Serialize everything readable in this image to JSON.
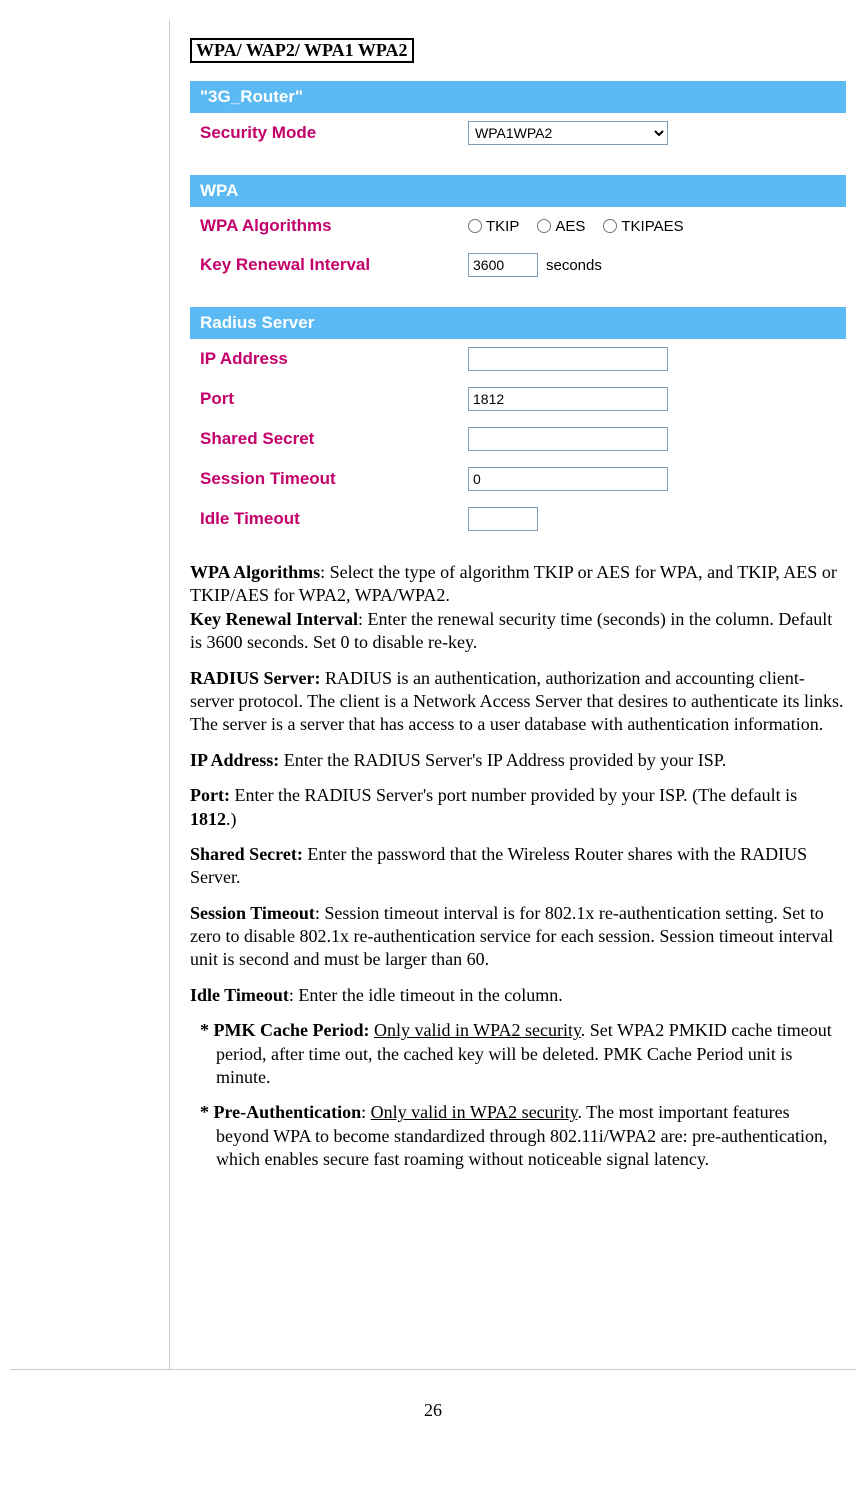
{
  "heading": "WPA/ WAP2/ WPA1 WPA2",
  "panel": {
    "bar_router": "\"3G_Router\"",
    "security_mode_label": "Security Mode",
    "security_mode_value": "WPA1WPA2",
    "bar_wpa": "WPA",
    "wpa_algo_label": "WPA Algorithms",
    "wpa_algo_opts": {
      "tkip": "TKIP",
      "aes": "AES",
      "tkipaes": "TKIPAES"
    },
    "key_renewal_label": "Key Renewal Interval",
    "key_renewal_value": "3600",
    "key_renewal_unit": "seconds",
    "bar_radius": "Radius Server",
    "ip_label": "IP Address",
    "ip_value": "",
    "port_label": "Port",
    "port_value": "1812",
    "secret_label": "Shared Secret",
    "secret_value": "",
    "session_label": "Session Timeout",
    "session_value": "0",
    "idle_label": "Idle Timeout",
    "idle_value": ""
  },
  "desc": {
    "wpa_algo_b": "WPA Algorithms",
    "wpa_algo_t": ": Select the type of algorithm TKIP or AES for WPA, and TKIP, AES or TKIP/AES for WPA2, WPA/WPA2.",
    "key_renewal_b": "Key Renewal Interval",
    "key_renewal_t": ": Enter the renewal security time (seconds) in the column. Default is 3600 seconds. Set 0 to disable re-key.",
    "radius_b": "RADIUS Server:",
    "radius_t": " RADIUS is an authentication, authorization and accounting client-server protocol. The client is a Network Access Server that desires to authenticate its links. The server is a server that has access to a user database with authentication information.",
    "ip_b": "IP Address:",
    "ip_t": " Enter the RADIUS Server's IP Address provided by your ISP.",
    "port_b": "Port:",
    "port_t1": " Enter the RADIUS Server's port number provided by your ISP. (The default is ",
    "port_t2": "1812",
    "port_t3": ".)",
    "secret_b": "Shared Secret:",
    "secret_t": " Enter the password that the Wireless  Router shares with the RADIUS Server.",
    "session_b": "Session Timeout",
    "session_t": ": Session timeout interval is for 802.1x re-authentication setting. Set to zero to disable 802.1x re-authentication service for each session. Session timeout interval unit is second and must be larger than 60.",
    "idle_b": "Idle Timeout",
    "idle_t": ": Enter the idle timeout in the column.",
    "pmk_b": "* PMK Cache Period:",
    "pmk_u": "Only valid in WPA2 security",
    "pmk_t": ". Set WPA2 PMKID cache timeout period, after time out, the cached key will be deleted. PMK Cache Period unit is minute.",
    "preauth_b": "* Pre-Authentication",
    "preauth_c": ": ",
    "preauth_u": "Only valid in WPA2 security",
    "preauth_t": ". The most important features beyond WPA to become standardized through 802.11i/WPA2 are: pre-authentication, which enables secure fast roaming without noticeable signal latency."
  },
  "page_num": "26"
}
